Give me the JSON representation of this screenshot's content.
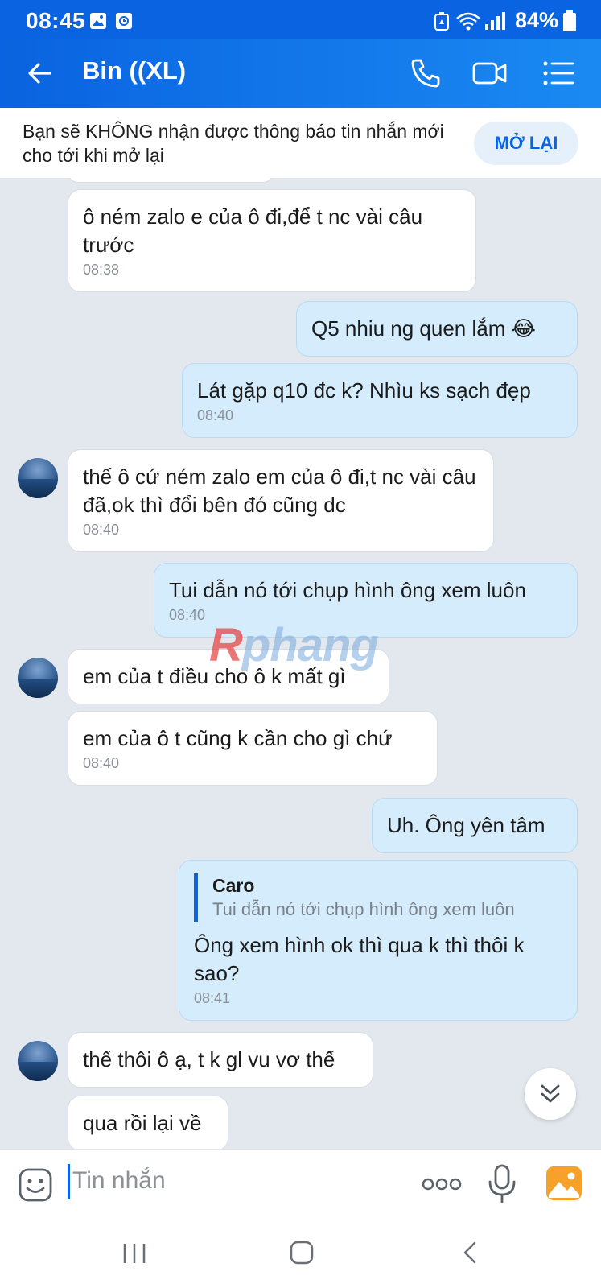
{
  "status_bar": {
    "time": "08:45",
    "battery": "84%"
  },
  "header": {
    "title": "Bin ((XL)"
  },
  "banner": {
    "text": "Bạn sẽ KHÔNG nhận được thông báo tin nhắn mới cho tới khi mở lại",
    "button": "MỞ LẠI"
  },
  "messages": [
    {
      "id": "m1",
      "text": "ô ném zalo e của ô đi,để t nc vài câu trước",
      "time": "08:38"
    },
    {
      "id": "m2",
      "text": "Q5 nhiu ng quen lắm 😂"
    },
    {
      "id": "m3",
      "text": "Lát gặp q10 đc k? Nhìu ks sạch đẹp",
      "time": "08:40"
    },
    {
      "id": "m4",
      "text": "thế ô cứ ném zalo em của ô đi,t nc vài câu đã,ok thì đổi bên đó cũng dc",
      "time": "08:40"
    },
    {
      "id": "m5",
      "text": "Tui dẫn nó tới chụp hình ông xem luôn",
      "time": "08:40"
    },
    {
      "id": "m6",
      "text": "em của t điều cho ô k mất gì"
    },
    {
      "id": "m7",
      "text": "em của ô t cũng k cần cho gì chứ",
      "time": "08:40"
    },
    {
      "id": "m8",
      "text": "Uh. Ông yên tâm"
    },
    {
      "id": "m9",
      "quote_author": "Caro",
      "quote_text": "Tui dẫn nó tới chụp hình ông xem luôn",
      "text": "Ông xem hình ok thì qua k thì thôi k sao?",
      "time": "08:41"
    },
    {
      "id": "m10",
      "text": "thế thôi ô ạ, t k gl vu vơ thế"
    },
    {
      "id": "m11",
      "text": "qua rồi lại về"
    }
  ],
  "watermark": {
    "first": "R",
    "rest": "phang"
  },
  "input": {
    "placeholder": "Tin nhắn"
  }
}
